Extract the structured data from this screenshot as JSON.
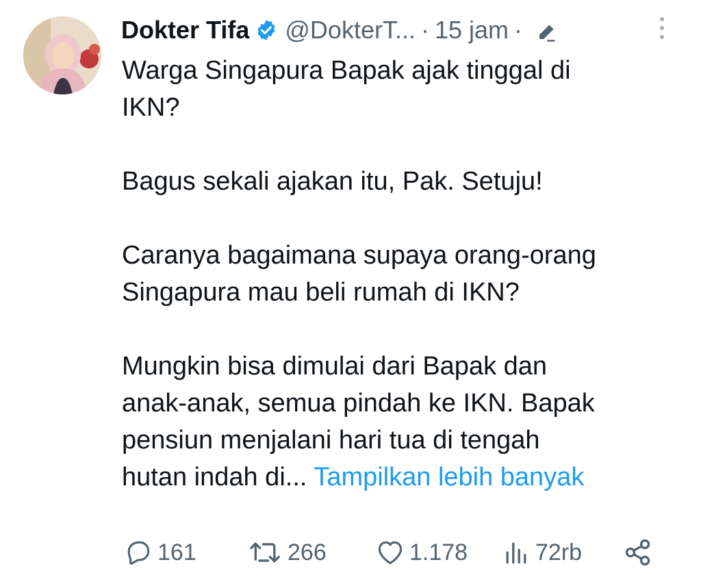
{
  "author": {
    "name": "Dokter Tifa",
    "handle": "@DokterT...",
    "separator": "·",
    "time": "15 jam",
    "avatar": "avatar-photo"
  },
  "icons": {
    "verified": "verified-badge-icon",
    "edited": "pencil-icon",
    "more": "more-vertical-icon",
    "reply": "reply-icon",
    "retweet": "retweet-icon",
    "like": "heart-icon",
    "views": "views-icon",
    "share": "share-icon"
  },
  "tweet": {
    "lines": [
      "Warga Singapura Bapak ajak tinggal di",
      "IKN?",
      "Bagus sekali ajakan itu, Pak.  Setuju!",
      "Caranya bagaimana supaya orang-orang",
      "Singapura mau beli rumah di IKN?",
      "Mungkin bisa dimulai dari Bapak dan",
      "anak-anak, semua pindah ke IKN. Bapak",
      "pensiun menjalani hari tua di tengah",
      "hutan indah di..."
    ],
    "show_more": "Tampilkan lebih banyak"
  },
  "stats": {
    "replies": "161",
    "retweets": "266",
    "likes": "1.178",
    "views": "72rb"
  },
  "colors": {
    "text": "#0f1419",
    "secondary": "#536471",
    "link": "#1d9bf0",
    "verified": "#1d9bf0",
    "background": "#ffffff"
  }
}
